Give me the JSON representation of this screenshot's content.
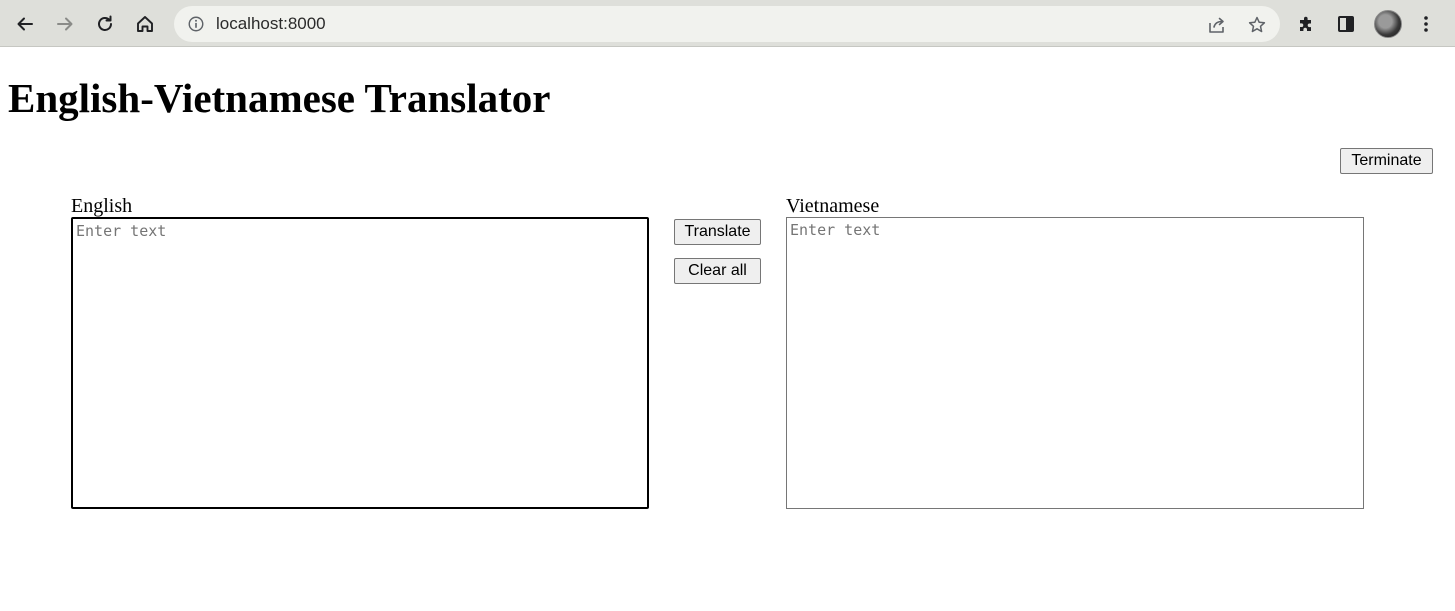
{
  "browser": {
    "url": "localhost:8000",
    "icons": {
      "back": "back-arrow-icon",
      "forward": "forward-arrow-icon",
      "reload": "reload-icon",
      "home": "home-icon",
      "info": "info-icon",
      "share": "share-icon",
      "bookmark": "star-icon",
      "extensions": "puzzle-icon",
      "side_panel": "side-panel-icon",
      "menu": "kebab-menu-icon"
    }
  },
  "page": {
    "title": "English-Vietnamese Translator",
    "terminate_label": "Terminate",
    "translate_label": "Translate",
    "clear_label": "Clear all",
    "english": {
      "label": "English",
      "placeholder": "Enter text",
      "value": ""
    },
    "vietnamese": {
      "label": "Vietnamese",
      "placeholder": "Enter text",
      "value": ""
    }
  }
}
